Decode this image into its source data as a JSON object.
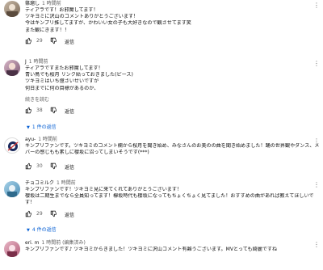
{
  "reply_label": "返信",
  "comments": [
    {
      "author": "篠瑠し",
      "time": "1 時間前",
      "lines": [
        "ティアラです！お邪魔してます！",
        "ツキヨミに沢山のコメントありがとうございます！",
        "今はキンプリ推してますが、かわいい女の子も大好きなので観させてます笑",
        "また観にきます！！"
      ],
      "likes": "29"
    },
    {
      "author": "J",
      "time": "1 時間前",
      "lines": [
        "ティアラですまたお邪魔してます！",
        "青い鳥でも桜月 リンク貼っておきました(ピース)",
        "ツキヨミはいち億さいせいですが",
        "何日までに何の目標があるのか、"
      ],
      "read_more": "続きを読む",
      "likes": "38",
      "replies": "1 件の返信"
    },
    {
      "author": "ayu-",
      "time": "1 時間前",
      "lines": [
        "キンプリファンです。ツキヨミのコメント欄から桜月を聞き始め、みなさんのお美のの曲を聞き始めました！踊の世界観やダンス、メン",
        "バーの感じもも素しに櫻坂に沼ってしまいそうです(***)"
      ],
      "likes": "30"
    },
    {
      "author": "チョコミルク",
      "time": "1 時間前",
      "lines": [
        "キンプリファンです！ツキヨミ見に来てくれてありがとうございます！",
        "櫻坂は二期生までなら全員知ってます！欅坂時代も櫻坂になってもちょくちょく見てました！おすすめの曲があれば教えてほしいで",
        "す！"
      ],
      "likes": "29",
      "replies": "4 件の返信"
    },
    {
      "author": "eri. m",
      "time": "1 時間前 (編集済み)",
      "lines": [
        "キンプリファンです♪ ツキヨミからきました！ツキヨミに沢山コメント有難うございます。MVとっても綺麗ですね"
      ]
    }
  ],
  "colors": {
    "link": "#065fd4",
    "muted": "#606060",
    "text": "#0f0f0f"
  }
}
